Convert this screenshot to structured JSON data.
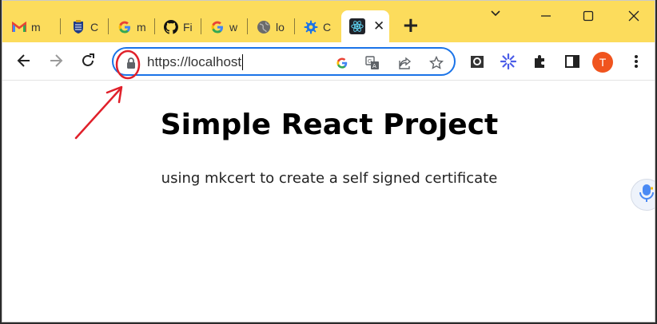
{
  "tabs": [
    {
      "label": "m",
      "icon": "gmail-icon"
    },
    {
      "label": "C",
      "icon": "crest-icon"
    },
    {
      "label": "m",
      "icon": "google-icon"
    },
    {
      "label": "Fi",
      "icon": "github-icon"
    },
    {
      "label": "w",
      "icon": "google-icon"
    },
    {
      "label": "lo",
      "icon": "globe-icon"
    },
    {
      "label": "C",
      "icon": "gear-icon"
    }
  ],
  "active_tab": {
    "icon": "react-icon",
    "close": "✕"
  },
  "new_tab": "+",
  "window_controls": {
    "minimize": "—",
    "maximize": "☐",
    "close": "✕",
    "tab_search": "⌄"
  },
  "toolbar": {
    "url": "https://localhost",
    "avatar_initial": "T"
  },
  "page": {
    "title": "Simple React Project",
    "subtitle": "using mkcert to create a self signed certificate"
  },
  "colors": {
    "tabstrip": "#fcdc5c",
    "focus_ring": "#1a73e8",
    "annotation": "#e0202a",
    "avatar": "#f0541e"
  }
}
